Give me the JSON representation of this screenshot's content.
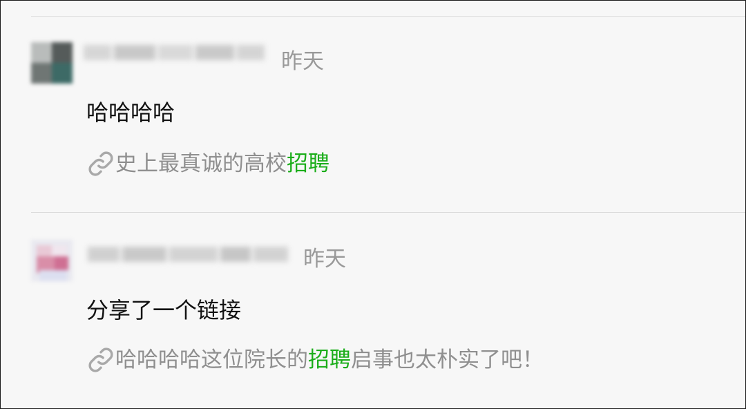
{
  "comments": [
    {
      "time": "昨天",
      "content": "哈哈哈哈",
      "link": {
        "pre": "史上最真诚的高校",
        "keyword": "招聘",
        "post": ""
      }
    },
    {
      "time": "昨天",
      "content": "分享了一个链接",
      "link": {
        "pre": "哈哈哈哈这位院长的",
        "keyword": "招聘",
        "post": "启事也太朴实了吧！"
      }
    }
  ],
  "colors": {
    "background": "#f7f7f7",
    "highlight": "#1aad19",
    "muted_text": "#999999",
    "divider": "#dcdcdc"
  },
  "icons": [
    "link-icon"
  ]
}
